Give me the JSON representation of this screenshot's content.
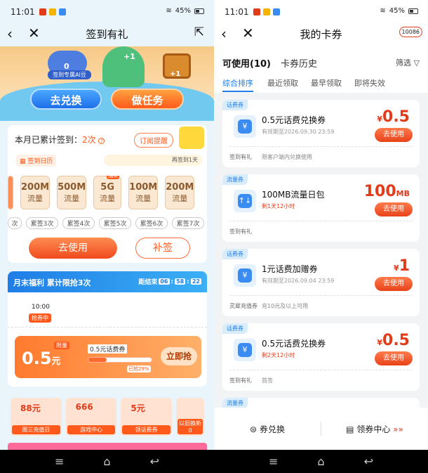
{
  "left": {
    "status": {
      "time": "11:01",
      "battery": "45%"
    },
    "title": "签到有礼",
    "hero": {
      "bean_count": "0",
      "bean_label": "签到专属AI豆",
      "plus_badge": "+1"
    },
    "buttons": {
      "exchange": "去兑换",
      "task": "做任务"
    },
    "sign": {
      "title_prefix": "本月已累计签到：",
      "count": "2次",
      "remind": "订阅提醒",
      "calendar": "签到日历",
      "next_hint": "再签到1天",
      "days": [
        {
          "value": "200M",
          "unit": "流量",
          "tag": ""
        },
        {
          "value": "500M",
          "unit": "流量",
          "tag": ""
        },
        {
          "value": "5G",
          "unit": "流量",
          "tag": "抽奖"
        },
        {
          "value": "100M",
          "unit": "流量",
          "tag": ""
        },
        {
          "value": "200M",
          "unit": "流量",
          "tag": ""
        }
      ],
      "day_labels": [
        "次",
        "累签3次",
        "累签4次",
        "累签5次",
        "累签6次",
        "累签7次"
      ],
      "use_btn": "去使用",
      "makeup_btn": "补签"
    },
    "month": {
      "title": "月末福利  累计限抢3次",
      "end_label": "距结束",
      "timer": [
        "06",
        "58",
        "22"
      ],
      "time": "10:00",
      "chip": "抢券中",
      "coupon": {
        "limit": "限量",
        "amount": "0.5",
        "unit": "元",
        "desc": "0.5元话费券",
        "grabbed_pct": 0.29,
        "grabbed": "已抢29%",
        "grab_btn": "立即抢"
      }
    },
    "entries": [
      {
        "big": "88元",
        "label": "周三充值日"
      },
      {
        "big": "666",
        "label": "游戏中心"
      },
      {
        "big": "5元",
        "label": "领话费券"
      },
      {
        "big": "",
        "label": "以旧换新0"
      }
    ]
  },
  "right": {
    "status": {
      "time": "11:01",
      "battery": "45%"
    },
    "title": "我的卡券",
    "brand": "10086",
    "tabs": {
      "usable": "可使用(10)",
      "history": "卡券历史",
      "filter": "筛选"
    },
    "sort": [
      "综合排序",
      "最近领取",
      "最早领取",
      "即将失效"
    ],
    "cards": [
      {
        "badge": "话费券",
        "icon": "¥",
        "name": "0.5元话费兑换券",
        "exp": "有效期至2026.09.30 23:59",
        "exp_red": false,
        "sym": "¥",
        "price": "0.5",
        "unit": "",
        "use": "去使用",
        "src": "签到有礼",
        "limit": "限客户端内兑换使用"
      },
      {
        "badge": "流量券",
        "icon": "↑↓",
        "name": "100MB流量日包",
        "exp": "剩1天12小时",
        "exp_red": true,
        "sym": "",
        "price": "100",
        "unit": "MB",
        "use": "去使用",
        "src": "签到有礼",
        "limit": ""
      },
      {
        "badge": "话费券",
        "icon": "¥",
        "name": "1元话费加赠券",
        "exp": "有效期至2026.09.04 23:59",
        "exp_red": false,
        "sym": "¥",
        "price": "1",
        "unit": "",
        "use": "去使用",
        "src": "灵犀充值券",
        "limit": "充10元及以上可用"
      },
      {
        "badge": "话费券",
        "icon": "¥",
        "name": "0.5元话费兑换券",
        "exp": "剩2天12小时",
        "exp_red": true,
        "sym": "¥",
        "price": "0.5",
        "unit": "",
        "use": "去使用",
        "src": "签到有礼",
        "limit": "首签"
      }
    ],
    "partial_badge": "流量券",
    "bottom": {
      "exchange": "券兑换",
      "center": "领券中心",
      "arrows": "»»"
    }
  }
}
